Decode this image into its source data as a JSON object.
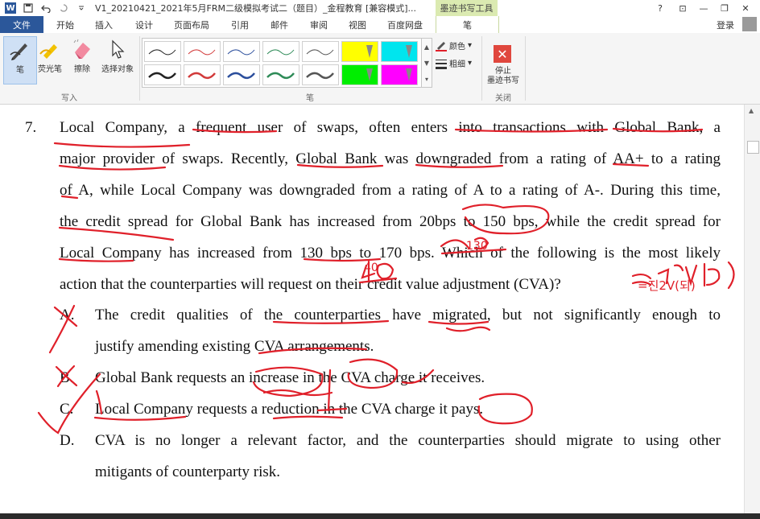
{
  "titlebar": {
    "app_letter": "W",
    "title": "V1_20210421_2021年5月FRM二级模拟考试二（题目）_金程教育 [兼容模式]...",
    "contextual_tool": "墨迹书写工具",
    "help": "?",
    "min": "—",
    "restore": "❐",
    "close": "✕",
    "ribbon_opts": "⊡"
  },
  "tabs": {
    "file": "文件",
    "items": [
      "开始",
      "插入",
      "设计",
      "页面布局",
      "引用",
      "邮件",
      "审阅",
      "视图",
      "百度网盘"
    ],
    "pen": "笔",
    "login": "登录"
  },
  "ribbon": {
    "write_group": {
      "label": "写入",
      "pen": "笔",
      "highlighter": "荧光笔",
      "eraser": "擦除",
      "select": "选择对象"
    },
    "pens_group": {
      "label": "笔",
      "swatches_top": [
        "#222222",
        "#d23a3a",
        "#2b4e9c",
        "#2e8b57",
        "#555555",
        "#ffff00",
        "#00e5ee"
      ],
      "swatches_bottom": [
        "#222222",
        "#d23a3a",
        "#2b4e9c",
        "#2e8b57",
        "#555555",
        "#00ee00",
        "#ff00ff"
      ],
      "color_label": "颜色",
      "thickness_label": "粗细"
    },
    "close_group": {
      "label": "关闭",
      "stop_line1": "停止",
      "stop_line2": "墨迹书写"
    }
  },
  "question": {
    "number": "7.",
    "lines": [
      "Local Company, a frequent user of swaps, often enters into transactions with Global Bank, a",
      "major provider of swaps. Recently, Global Bank was downgraded from a rating of AA+ to a rating",
      "of A, while Local Company was downgraded from a rating of A to a rating of A-. During this time,",
      "the credit spread for Global Bank has increased from 20bps to 150 bps, while the credit spread for",
      "Local Company has increased from 130 bps to 170 bps. Which of the following is the most likely",
      "action that the counterparties will request on their credit value adjustment (CVA)?"
    ],
    "options": [
      {
        "letter": "A.",
        "lines": [
          "The credit qualities of the counterparties have migrated, but not significantly enough to",
          "justify amending existing CVA arrangements."
        ]
      },
      {
        "letter": "B.",
        "lines": [
          "Global Bank requests an increase in the CVA charge it receives."
        ]
      },
      {
        "letter": "C.",
        "lines": [
          "Local Company requests a reduction in the CVA charge it pays."
        ]
      },
      {
        "letter": "D.",
        "lines": [
          "CVA is no longer a relevant factor, and the counterparties should migrate to using other",
          "mitigants of counterparty risk."
        ]
      }
    ]
  },
  "annotations": {
    "note_130": "130",
    "note_40": "40",
    "note_cva": "=진2V(되)"
  },
  "ink_color": "#e0202a"
}
